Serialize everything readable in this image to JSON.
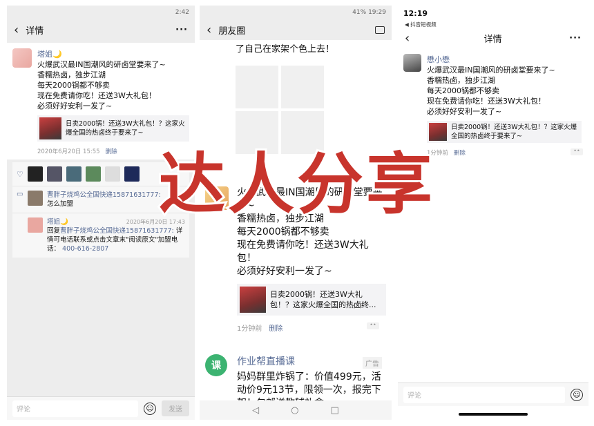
{
  "panel1": {
    "status_time": "2:42",
    "nav_title": "详情",
    "more": "···",
    "post": {
      "author": "塔姐🌙",
      "text": "火爆武汉最IN国潮风的研卤堂要来了~\n香糯热卤，独步江湖\n每天2000锅都不够卖\n现在免费请你吃！还送3W大礼包！\n必须好好安利一发了~",
      "link_text": "日卖2000锅！还送3W大礼包！？这家火爆全国的热卤终于要来了~",
      "time": "2020年6月20日 15:55",
      "delete": "删除"
    },
    "comments": [
      {
        "author": "曹胖子烧鸡公全国快递15871631777:",
        "text": "怎么加盟",
        "time": ""
      },
      {
        "author": "塔姐🌙",
        "time": "2020年6月20日 17:43",
        "reply_prefix": "回复",
        "reply_to": "曹胖子烧鸡公全国快递15871631777:",
        "text": "详情可电话联系或点击文章末\"阅读原文\"加盟电话：",
        "phone": "400-616-2807"
      }
    ],
    "comment_placeholder": "评论",
    "send": "发送"
  },
  "panel2": {
    "status_battery": "41%",
    "status_time": "19:29",
    "nav_title": "朋友圈",
    "cut_text": "了自己在家架个色上去！",
    "post": {
      "text": "火爆武汉最IN国潮风的研卤堂要来了~\n香糯热卤，独步江湖\n每天2000锅都不够卖\n现在免费请你吃！还送3W大礼包！\n必须好好安利一发了~",
      "link_text": "日卖2000锅！还送3W大礼包！？这家火爆全国的热卤终...",
      "time": "1分钟前",
      "delete": "删除"
    },
    "ad": {
      "logo": "课",
      "name": "作业帮直播课",
      "tag": "广告",
      "text": "妈妈群里炸锅了：价值499元，活动价9元13节，限领一次，报完下架！包邮送教辅礼盒~"
    }
  },
  "panel3": {
    "status_time": "12:19",
    "source": "◀ 抖音短视频",
    "nav_title": "详情",
    "more": "···",
    "post": {
      "author": "懋小懋",
      "text": "火爆武汉最IN国潮风的研卤堂要来了~\n香糯热卤，独步江湖\n每天2000锅都不够卖\n现在免费请你吃！还送3W大礼包！\n必须好好安利一发了~",
      "link_text": "日卖2000锅！还送3W大礼包！？这家火爆全国的热卤终于要来了~",
      "time": "1分钟前",
      "delete": "删除"
    },
    "comment_placeholder": "评论"
  },
  "overlay_text": "达人分享",
  "colors": {
    "accent_red": "#c8342c",
    "link_blue": "#576b95"
  }
}
